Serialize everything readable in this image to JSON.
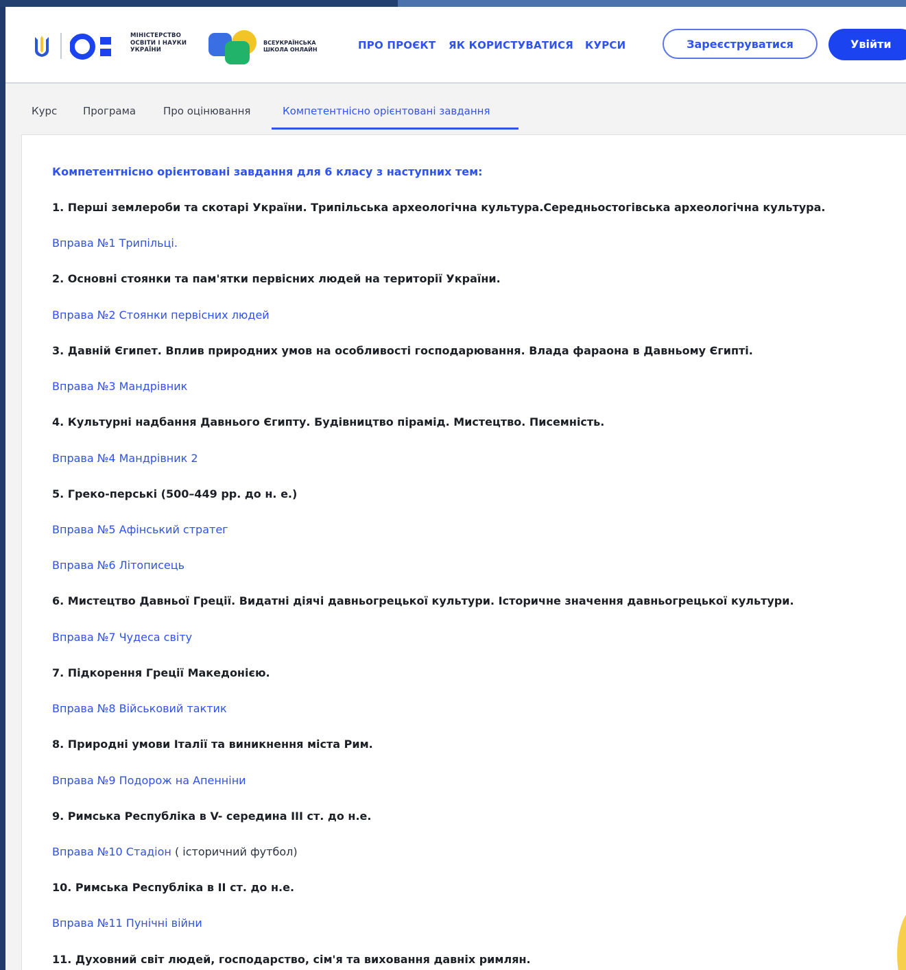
{
  "header": {
    "ministry_logo_text": [
      "МІНІСТЕРСТВО",
      "ОСВІТИ І НАУКИ",
      "УКРАЇНИ"
    ],
    "school_logo_text": [
      "ВСЕУКРАЇНСЬКА",
      "ШКОЛА ОНЛАЙН"
    ],
    "nav": [
      "ПРО ПРОЄКТ",
      "ЯК КОРИСТУВАТИСЯ",
      "КУРСИ"
    ],
    "register_label": "Зареєструватися",
    "login_label": "Увійти"
  },
  "tabs": {
    "items": [
      "Курс",
      "Програма",
      "Про оцінювання",
      "Компетентнісно орієнтовані завдання"
    ],
    "active": "Компетентнісно орієнтовані завдання"
  },
  "content": {
    "heading": "Компетентнісно орієнтовані завдання для 6 класу з наступних тем:",
    "rows": [
      {
        "type": "topic",
        "text": "1. Перші землероби та скотарі України. Трипільська археологічна культура.Середньостогівська археологічна культура."
      },
      {
        "type": "link",
        "text": "Вправа №1 Трипільці."
      },
      {
        "type": "topic",
        "text": "2. Основні стоянки та пам'ятки первісних людей на території України."
      },
      {
        "type": "link",
        "text": "Вправа №2 Стоянки первісних людей"
      },
      {
        "type": "topic",
        "text": "3. Давній Єгипет. Вплив природних умов на особливості господарювання. Влада фараона в Давньому Єгипті."
      },
      {
        "type": "link",
        "text": "Вправа №3 Мандрівник"
      },
      {
        "type": "topic",
        "text": "4. Культурні надбання Давнього Єгипту. Будівництво пірамід. Мистецтво. Писемність."
      },
      {
        "type": "link",
        "text": "Вправа №4 Мандрівник 2"
      },
      {
        "type": "topic",
        "text": "5. Греко-перські (500–449 рр. до н. е.)"
      },
      {
        "type": "link",
        "text": "Вправа №5 Афінський стратег"
      },
      {
        "type": "link",
        "text": "Вправа №6 Літописець"
      },
      {
        "type": "topic",
        "text": "6. Мистецтво Давньої Греції. Видатні діячі давньогрецької культури. Історичне значення давньогрецької культури."
      },
      {
        "type": "link",
        "text": "Вправа №7 Чудеса світу"
      },
      {
        "type": "topic",
        "text": "7. Підкорення Греції Македонією."
      },
      {
        "type": "link",
        "text": "Вправа №8 Військовий тактик"
      },
      {
        "type": "topic",
        "text": "8. Природні умови Італії та виникнення міста Рим."
      },
      {
        "type": "link",
        "text": "Вправа №9 Подорож на Апенніни"
      },
      {
        "type": "topic",
        "text": "9. Римська Республіка в V- середина III ст. до н.е."
      },
      {
        "type": "link",
        "text": "Вправа №10 Стадіон",
        "suffix": " ( історичний футбол)"
      },
      {
        "type": "topic",
        "text": "10. Римська Республіка в II ст. до н.е."
      },
      {
        "type": "link",
        "text": "Вправа №11 Пунічні війни"
      },
      {
        "type": "topic",
        "text": "11. Духовний світ людей, господарство, сім'я та виховання давніх римлян."
      }
    ]
  },
  "colors": {
    "accent": "#2f53f0",
    "frame": "#1f3a6b",
    "topic_text": "#1c1f26"
  }
}
